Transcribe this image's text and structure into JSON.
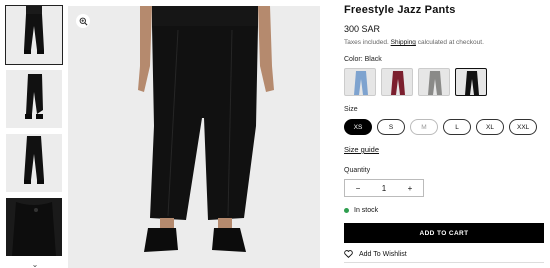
{
  "product": {
    "title": "Freestyle Jazz Pants",
    "price": "300 SAR",
    "tax_prefix": "Taxes included.",
    "tax_link": "Shipping",
    "tax_suffix": "calculated at checkout."
  },
  "color": {
    "label": "Color: Black",
    "options": [
      {
        "name": "Light Blue",
        "color": "#7ea3cf"
      },
      {
        "name": "Burgundy",
        "color": "#7b1f2e"
      },
      {
        "name": "Grey",
        "color": "#8a8a88"
      },
      {
        "name": "Black",
        "color": "#111111",
        "selected": true
      }
    ]
  },
  "size": {
    "label": "Size",
    "options": [
      {
        "label": "XS",
        "state": "selected"
      },
      {
        "label": "S",
        "state": "available"
      },
      {
        "label": "M",
        "state": "unavailable"
      },
      {
        "label": "L",
        "state": "available"
      },
      {
        "label": "XL",
        "state": "available"
      },
      {
        "label": "XXL",
        "state": "available"
      }
    ],
    "guide": "Size guide"
  },
  "quantity": {
    "label": "Quantity",
    "minus": "−",
    "value": "1",
    "plus": "+"
  },
  "stock": {
    "text": "In stock",
    "color": "#2e9e4f"
  },
  "actions": {
    "add_to_cart": "ADD TO CART",
    "wishlist": "Add To Wishlist"
  },
  "gallery": {
    "more_indicator": "⌄"
  },
  "icons": {
    "zoom": "zoom-in-icon",
    "heart": "heart-icon"
  }
}
